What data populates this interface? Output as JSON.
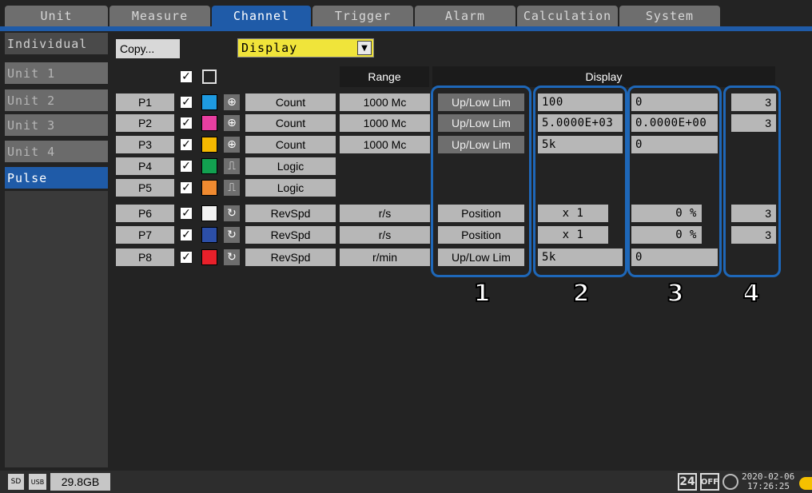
{
  "tabs": [
    {
      "label": "Unit"
    },
    {
      "label": "Measure"
    },
    {
      "label": "Channel"
    },
    {
      "label": "Trigger"
    },
    {
      "label": "Alarm"
    },
    {
      "label": "Calculation"
    },
    {
      "label": "System"
    }
  ],
  "active_tab": "Channel",
  "sidebar": {
    "items": [
      {
        "label": "Individual"
      },
      {
        "label": "Unit 1"
      },
      {
        "label": "Unit 2"
      },
      {
        "label": "Unit 3"
      },
      {
        "label": "Unit 4"
      },
      {
        "label": "Pulse"
      }
    ],
    "active": "Pulse"
  },
  "toolbar": {
    "copy_label": "Copy...",
    "view_select": "Display"
  },
  "headers": {
    "range": "Range",
    "display": "Display"
  },
  "rows": [
    {
      "ch": "P1",
      "color": "#1e9ae0",
      "icon": "counter-icon",
      "type": "Count",
      "range": "1000 Mc",
      "mode": "Up/Low Lim",
      "v2": "100",
      "v3": "0",
      "v4": "3"
    },
    {
      "ch": "P2",
      "color": "#e83fa0",
      "icon": "counter-icon",
      "type": "Count",
      "range": "1000 Mc",
      "mode": "Up/Low Lim",
      "v2": "5.0000E+03",
      "v3": "0.0000E+00",
      "v4": "3"
    },
    {
      "ch": "P3",
      "color": "#f5b800",
      "icon": "counter-icon",
      "type": "Count",
      "range": "1000 Mc",
      "mode": "Up/Low Lim",
      "v2": "5k",
      "v3": "0",
      "v4": ""
    },
    {
      "ch": "P4",
      "color": "#12a050",
      "icon": "logic-icon",
      "type": "Logic",
      "range": "",
      "mode": "",
      "v2": "",
      "v3": "",
      "v4": ""
    },
    {
      "ch": "P5",
      "color": "#f08a30",
      "icon": "logic-icon",
      "type": "Logic",
      "range": "",
      "mode": "",
      "v2": "",
      "v3": "",
      "v4": ""
    },
    {
      "ch": "P6",
      "color": "#f2f2f2",
      "icon": "rotation-icon",
      "type": "RevSpd",
      "range": "r/s",
      "mode": "Position",
      "v2": "x 1",
      "v3": "0 %",
      "v4": "3"
    },
    {
      "ch": "P7",
      "color": "#2c4fa8",
      "icon": "rotation-icon",
      "type": "RevSpd",
      "range": "r/s",
      "mode": "Position",
      "v2": "x 1",
      "v3": "0 %",
      "v4": "3"
    },
    {
      "ch": "P8",
      "color": "#e8202a",
      "icon": "rotation-icon",
      "type": "RevSpd",
      "range": "r/min",
      "mode": "Up/Low Lim",
      "v2": "5k",
      "v3": "0",
      "v4": ""
    }
  ],
  "callouts": [
    "1",
    "2",
    "3",
    "4"
  ],
  "status": {
    "sd_icon": "SD",
    "usb_icon": "USB",
    "storage": "29.8GB",
    "trigger_count": "24",
    "off_badge": "OFF",
    "date": "2020-02-06",
    "time": "17:26:25"
  }
}
